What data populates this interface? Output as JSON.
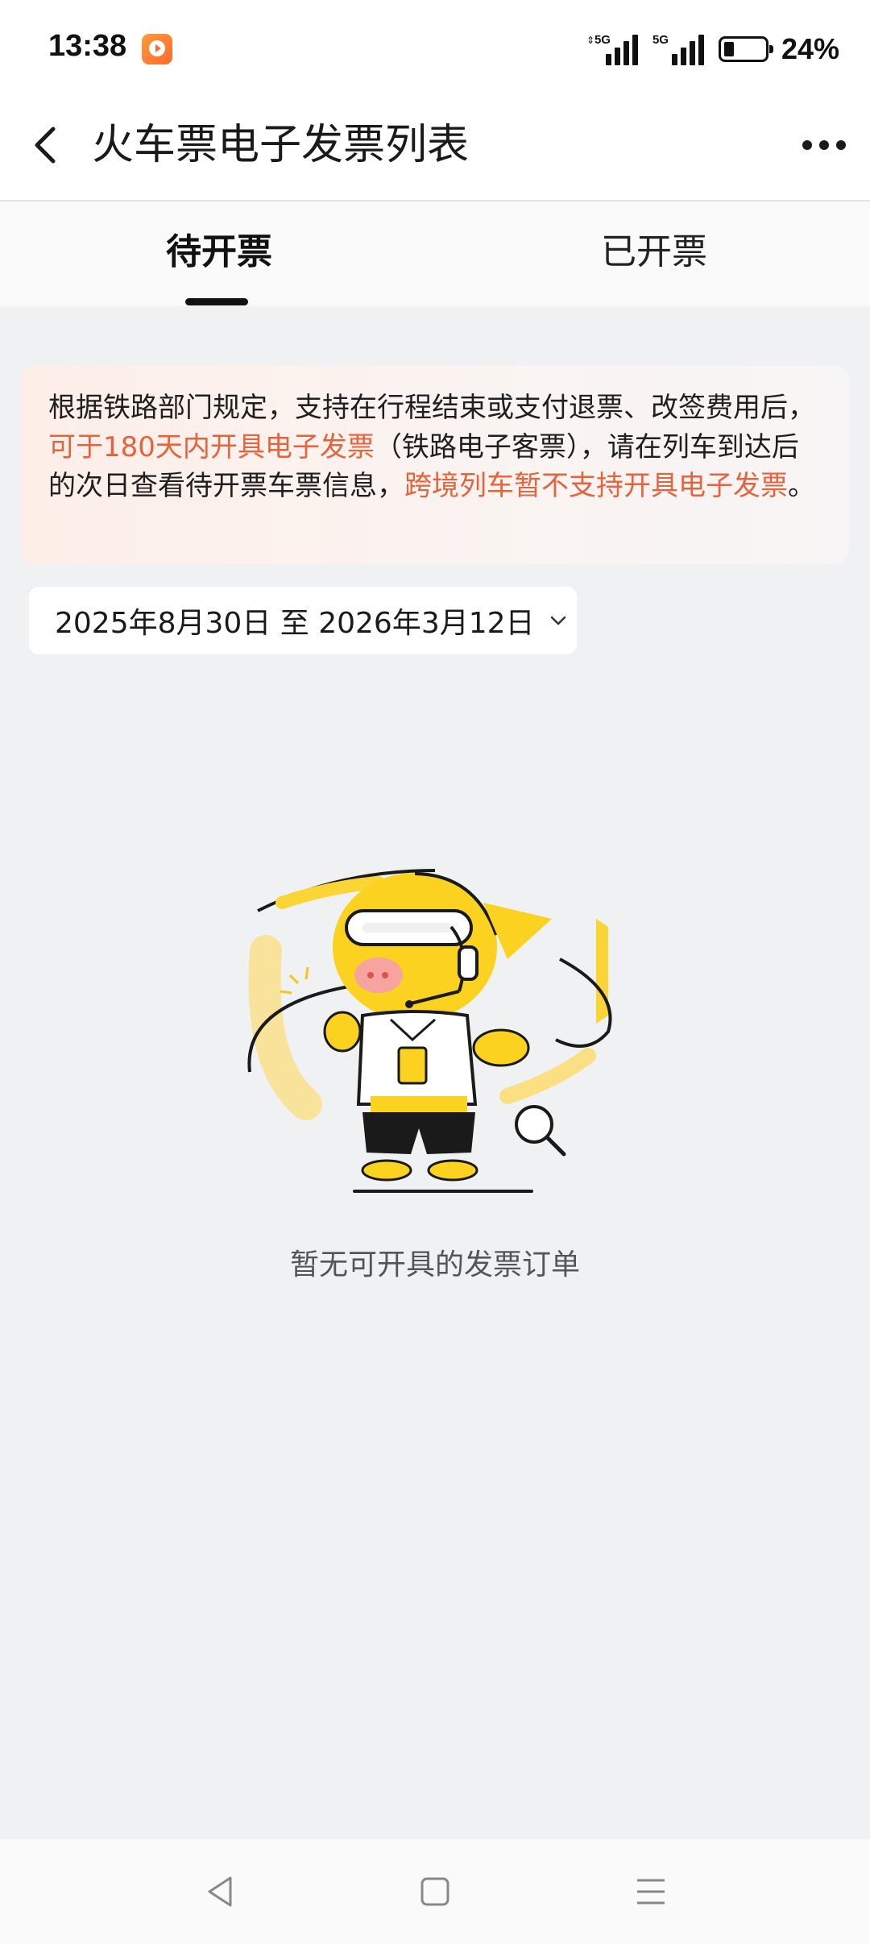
{
  "status_bar": {
    "time": "13:38",
    "signal_1": "5G",
    "signal_2": "5G",
    "battery_percent": "24%",
    "battery_level": 0.24
  },
  "nav": {
    "title": "火车票电子发票列表",
    "back_icon": "chevron-left-icon",
    "more_icon": "more-dots-icon"
  },
  "tabs": [
    {
      "label": "待开票",
      "active": true
    },
    {
      "label": "已开票",
      "active": false
    }
  ],
  "notice": {
    "part1": "根据铁路部门规定，支持在行程结束或支付退票、改签费用后，",
    "highlight1": "可于180天内开具电子发票",
    "part2": "（铁路电子客票），请在列车到达后的次日查看待开票车票信息，",
    "highlight2": "跨境列车暂不支持开具电子发票",
    "part3": "。",
    "highlight_color": "#e8623c"
  },
  "date_filter": {
    "label": "2025年8月30日 至 2026年3月12日"
  },
  "empty_state": {
    "message": "暂无可开具的发票订单"
  },
  "system_nav": {
    "back": "triangle-back-icon",
    "home": "square-home-icon",
    "menu": "hamburger-menu-icon"
  }
}
